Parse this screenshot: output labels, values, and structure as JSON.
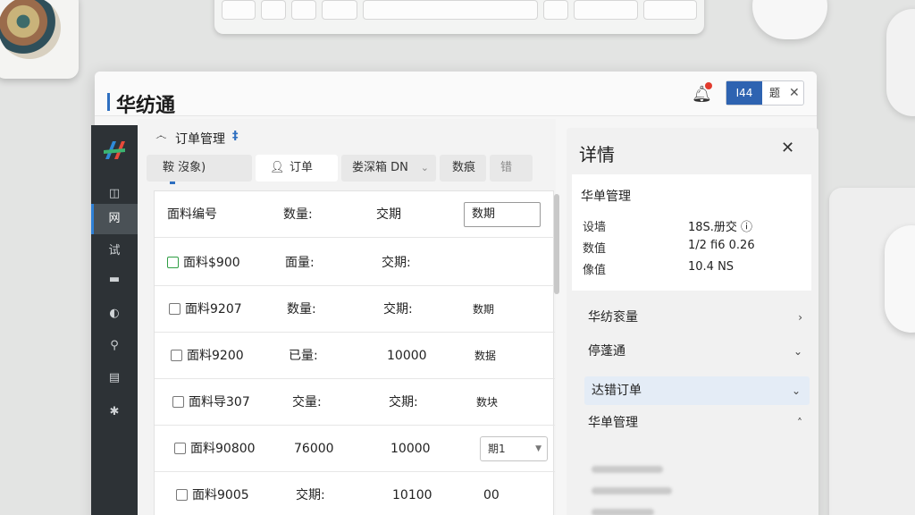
{
  "app": {
    "title": "华纺通"
  },
  "toolbar": {
    "button_primary": "I44",
    "button_text": "题",
    "close_glyph": "✕",
    "bell_icon": "bell-icon"
  },
  "sidebar": {
    "items": [
      {
        "label": "◫",
        "icon": "window-icon"
      },
      {
        "label": "网",
        "icon": "orders-icon",
        "active": true
      },
      {
        "label": "试",
        "icon": "test-icon"
      },
      {
        "label": "▬",
        "icon": "monitor-icon"
      },
      {
        "label": "◐",
        "icon": "chart-icon"
      },
      {
        "label": "⚲",
        "icon": "search-icon"
      },
      {
        "label": "▤",
        "icon": "database-icon"
      },
      {
        "label": "✱",
        "icon": "gear-icon"
      }
    ]
  },
  "order_panel": {
    "icon_text": "෴",
    "title": "订单管理",
    "title_mark": "‡",
    "tabs": [
      {
        "label": "鞍 沒象)"
      },
      {
        "label": "订单",
        "active": true
      },
      {
        "label": "娄深箱 DN"
      },
      {
        "label": "数痕"
      },
      {
        "label": "错"
      }
    ],
    "header": {
      "col1": "面料编号",
      "col2": "数量:",
      "col3": "交期",
      "col4_input": "数期"
    },
    "rows": [
      {
        "id": "面料$900",
        "qty": "面量:",
        "date": "交期:",
        "extra": "",
        "checkbox": "green"
      },
      {
        "id": "面料9207",
        "qty": "数量:",
        "date": "交期:",
        "extra": "数期"
      },
      {
        "id": "面料9200",
        "qty": "已量:",
        "date": "10000",
        "extra": "数据"
      },
      {
        "id": "面料导307",
        "qty": "交量:",
        "date": "交期:",
        "extra": "数块"
      },
      {
        "id": "面料90800",
        "qty": "76000",
        "date": "10000",
        "extra_select": "期1"
      },
      {
        "id": "面料9005",
        "qty": "交期:",
        "date": "10100",
        "extra": "00"
      }
    ]
  },
  "detail_panel": {
    "title": "详情",
    "close": "✕",
    "card": {
      "title": "华单管理",
      "rows": [
        {
          "k": "设墙",
          "v": "18S.册交 ⓘ"
        },
        {
          "k": "数值",
          "v": "1/2 fi6 0.26"
        },
        {
          "k": "像值",
          "v": "10.4 NS"
        }
      ]
    },
    "accordions": [
      {
        "label": "华纺衮量",
        "chevron": "›"
      },
      {
        "label": "停蓬通",
        "chevron": "⌄"
      },
      {
        "label": "达错订单",
        "chevron": "⌄",
        "selected": true
      },
      {
        "label": "华单管理",
        "chevron": "˄"
      }
    ]
  }
}
